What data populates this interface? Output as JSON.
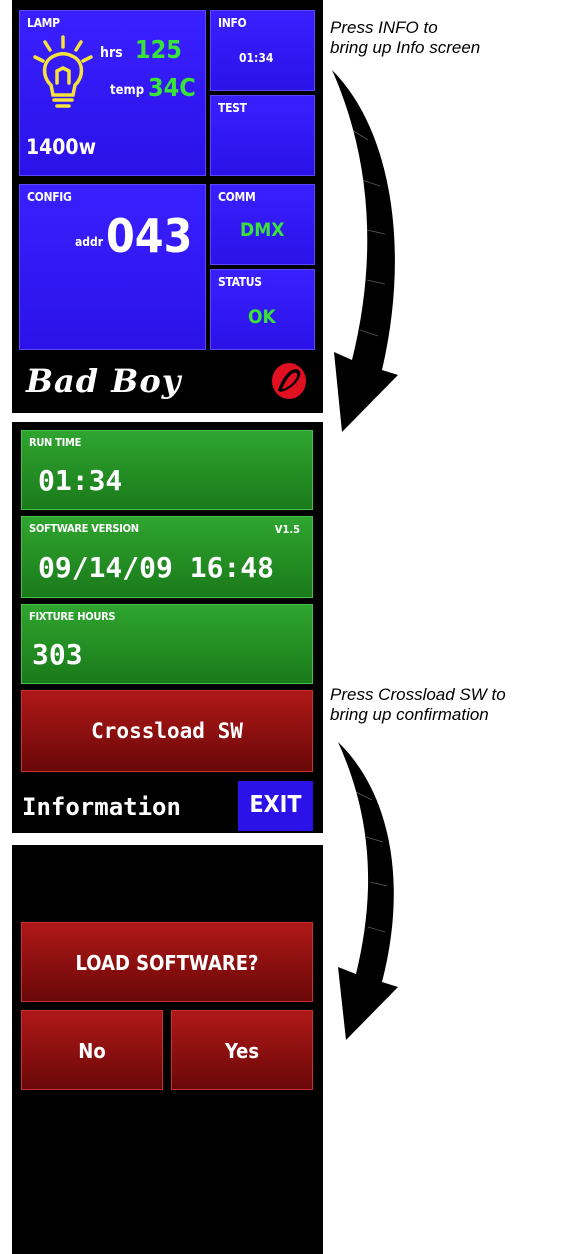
{
  "screen1": {
    "lamp": {
      "label": "LAMP",
      "hrs_label": "hrs",
      "hrs_value": "125",
      "temp_label": "temp",
      "temp_value": "34C",
      "wattage": "1400w"
    },
    "info": {
      "label": "INFO",
      "value": "01:34"
    },
    "test": {
      "label": "TEST"
    },
    "config": {
      "label": "CONFIG",
      "addr_label": "addr",
      "addr_value": "043"
    },
    "comm": {
      "label": "COMM",
      "value": "DMX"
    },
    "status": {
      "label": "STATUS",
      "value": "OK"
    },
    "brand": "Bad Boy"
  },
  "screen2": {
    "runtime": {
      "label": "RUN TIME",
      "value": "01:34"
    },
    "software": {
      "label": "SOFTWARE VERSION",
      "version": "V1.5",
      "value": "09/14/09 16:48"
    },
    "fixture": {
      "label": "FIXTURE HOURS",
      "value": "303"
    },
    "crossload_label": "Crossload SW",
    "title": "Information",
    "exit_label": "EXIT"
  },
  "screen3": {
    "prompt": "LOAD SOFTWARE?",
    "no_label": "No",
    "yes_label": "Yes"
  },
  "annotations": {
    "note1_line1": "Press INFO to",
    "note1_line2": "bring up Info screen",
    "note2_line1": "Press Crossload SW to",
    "note2_line2": "bring up confirmation"
  },
  "colors": {
    "tile_blue": "#2a12e8",
    "value_green": "#39e339",
    "tile_green": "#1f8a1f",
    "tile_red": "#8a0e0e"
  }
}
